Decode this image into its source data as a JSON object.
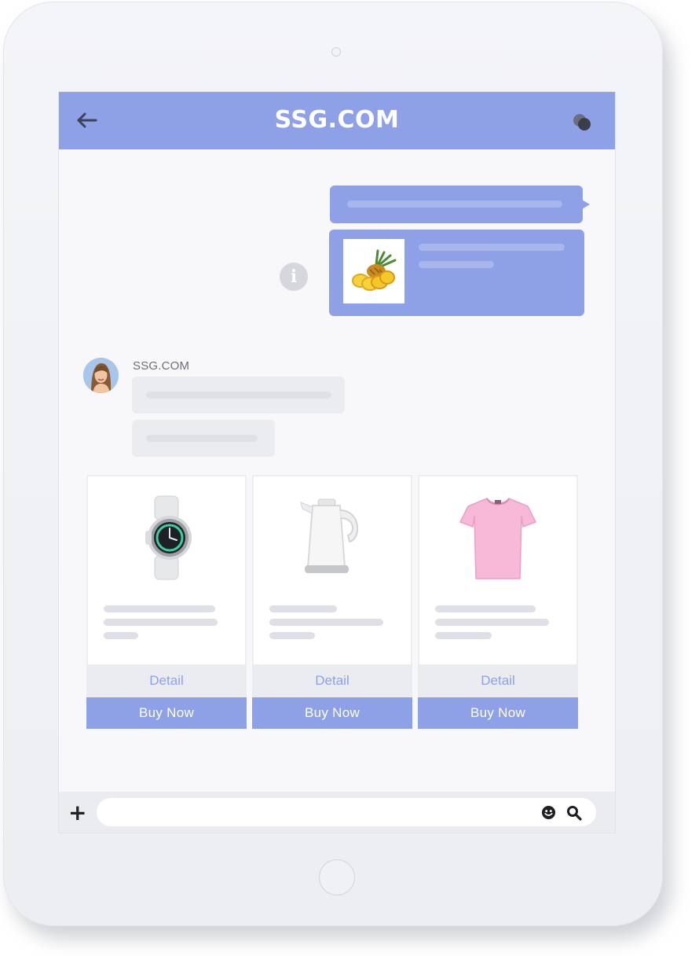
{
  "header": {
    "title": "SSG.COM",
    "back_icon": "arrow-left-icon",
    "chat_icon": "chat-bubbles-icon"
  },
  "conversation": {
    "outgoing_product_icon": "pineapple-image",
    "info_icon_glyph": "i",
    "incoming": {
      "sender": "SSG.COM",
      "avatar": "woman-avatar"
    }
  },
  "products": [
    {
      "image": "smartwatch-image",
      "detail_label": "Detail",
      "buy_label": "Buy Now"
    },
    {
      "image": "electric-kettle-image",
      "detail_label": "Detail",
      "buy_label": "Buy Now"
    },
    {
      "image": "pink-tshirt-image",
      "detail_label": "Detail",
      "buy_label": "Buy Now"
    }
  ],
  "input_bar": {
    "plus_glyph": "+",
    "placeholder": "",
    "emoji_icon": "smiley-icon",
    "search_icon": "magnifier-icon"
  },
  "colors": {
    "accent": "#8fa1e6",
    "bubble_grey": "#ebecf0",
    "screen_bg": "#f8f8fa"
  }
}
